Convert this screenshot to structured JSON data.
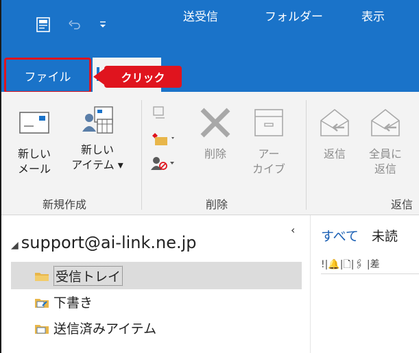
{
  "tabs": {
    "file": "ファイル",
    "send_receive": "送受信",
    "folder": "フォルダー",
    "view": "表示"
  },
  "callout": {
    "label": "クリック"
  },
  "ribbon": {
    "new_mail": [
      "新しい",
      "メール"
    ],
    "new_item": [
      "新しい",
      "アイテム ▾"
    ],
    "delete": "削除",
    "archive": [
      "アー",
      "カイブ"
    ],
    "reply": "返信",
    "reply_all": [
      "全員に",
      "返信"
    ],
    "group_new": "新規作成",
    "group_delete": "削除",
    "group_respond": "返信"
  },
  "folders": {
    "account": "support@ai-link.ne.jp",
    "items": [
      "受信トレイ",
      "下書き",
      "送信済みアイテム"
    ]
  },
  "message_list": {
    "filter_all": "すべて",
    "filter_unread": "未読",
    "columns": "!|🔔|🗋|🖇 |差"
  },
  "colors": {
    "accent": "#1a73c9",
    "callout": "#e0141e"
  }
}
